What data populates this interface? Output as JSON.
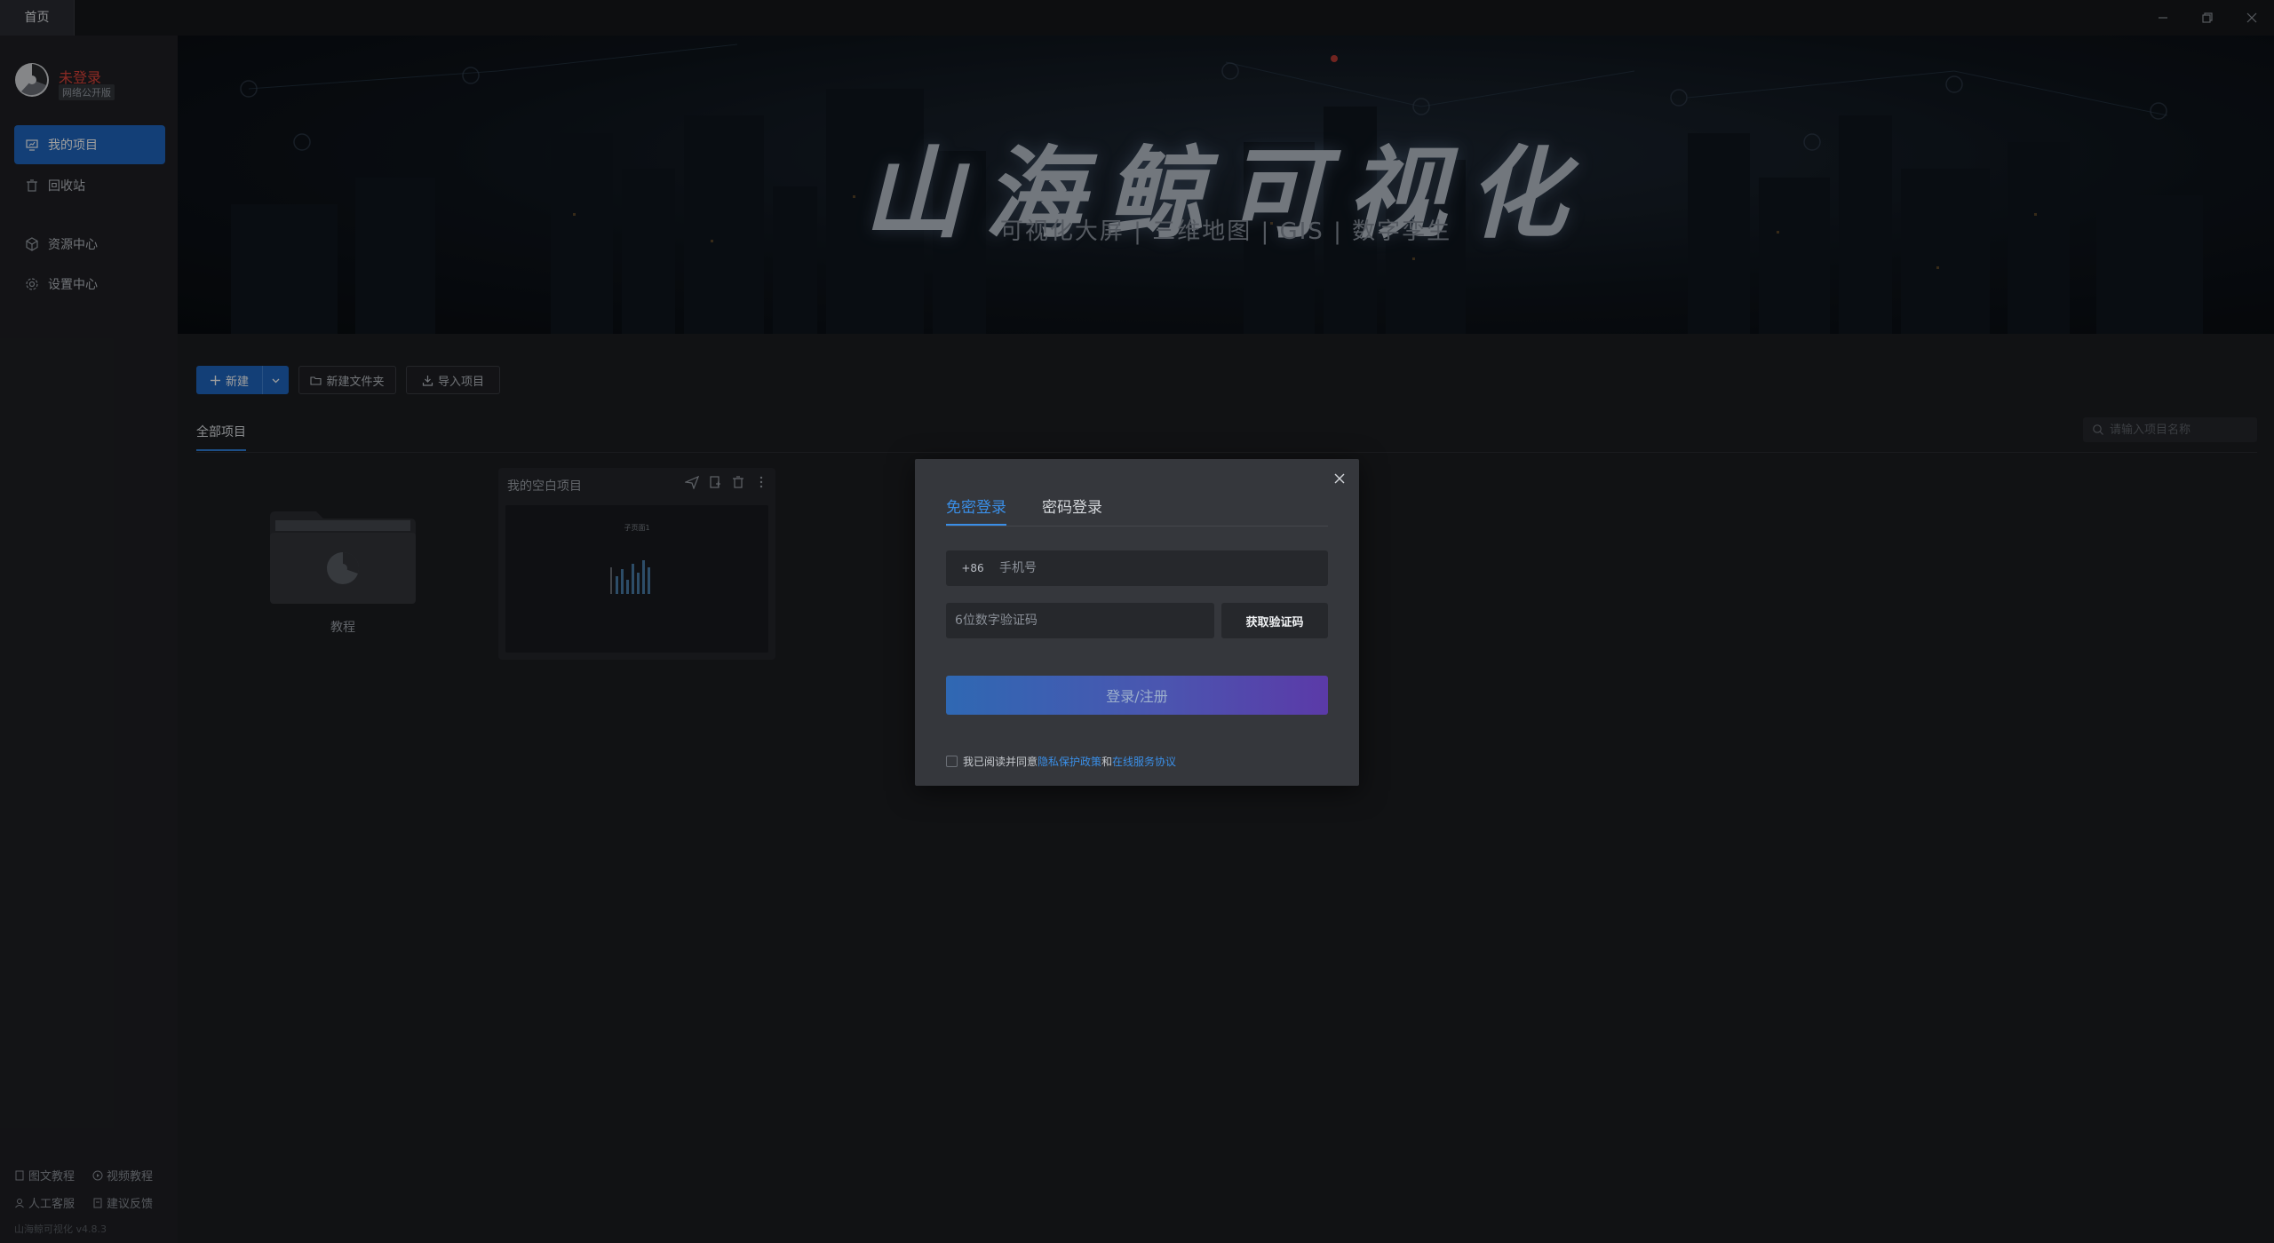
{
  "titlebar": {
    "tab": "首页"
  },
  "sidebar": {
    "user_name": "未登录",
    "user_badge": "网络公开版",
    "nav": [
      {
        "label": "我的项目",
        "icon": "projects-icon",
        "active": true
      },
      {
        "label": "回收站",
        "icon": "trash-icon"
      },
      {
        "label": "资源中心",
        "icon": "cube-icon"
      },
      {
        "label": "设置中心",
        "icon": "gear-icon"
      }
    ],
    "footer": {
      "doc_tutorial": "图文教程",
      "video_tutorial": "视频教程",
      "support": "人工客服",
      "feedback": "建议反馈",
      "version": "山海鲸可视化 v4.8.3"
    }
  },
  "banner": {
    "title": "山海鲸可视化",
    "subtitle": "可视化大屏   |   三维地图   |   GIS   |   数字孪生"
  },
  "toolbar": {
    "new_label": "新建",
    "new_folder_label": "新建文件夹",
    "import_label": "导入项目"
  },
  "tabs": {
    "all": "全部项目"
  },
  "search": {
    "placeholder": "请输入项目名称"
  },
  "cards": {
    "folder_label": "教程",
    "project_name": "我的空白项目",
    "thumb_title": "子页面1"
  },
  "modal": {
    "tab_sms": "免密登录",
    "tab_password": "密码登录",
    "country_code": "+86",
    "phone_placeholder": "手机号",
    "code_placeholder": "6位数字验证码",
    "get_code": "获取验证码",
    "submit": "登录/注册",
    "agree_prefix": "我已阅读并同意",
    "privacy": "隐私保护政策",
    "and": "和",
    "terms": "在线服务协议"
  },
  "colors": {
    "accent": "#1f67c0",
    "link": "#3a8ee6",
    "danger": "#e0443a"
  }
}
